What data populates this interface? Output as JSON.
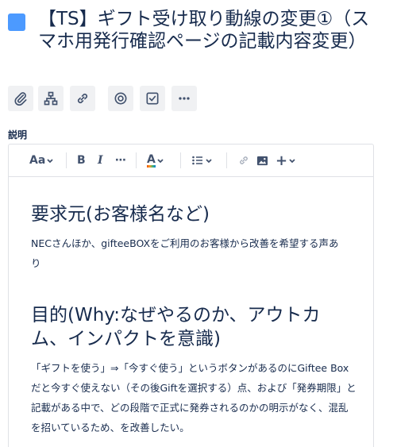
{
  "issue": {
    "title": "【TS】ギフト受け取り動線の変更①（スマホ用発行確認ページの記載内容変更）",
    "type_color": "#4c9aff"
  },
  "actions": [
    {
      "name": "attach-button",
      "icon": "paperclip-icon"
    },
    {
      "name": "child-issue-button",
      "icon": "hierarchy-icon"
    },
    {
      "name": "link-issue-button",
      "icon": "link-icon"
    },
    {
      "name": "watch-button",
      "icon": "target-icon"
    },
    {
      "name": "checklist-button",
      "icon": "checkbox-icon"
    },
    {
      "name": "more-button",
      "icon": "more-icon"
    }
  ],
  "description": {
    "label": "説明",
    "toolbar": {
      "text_style": "Aa",
      "bold": "B",
      "italic": "I",
      "more": "⋯",
      "color": "A",
      "plus": "+"
    },
    "heading1": "要求元(お客様名など)",
    "para1": "NECさんほか、gifteeBOXをご利用のお客様から改善を希望する声あり",
    "heading2": "目的(Why:なぜやるのか、アウトカム、インパクトを意識)",
    "para2": "「ギフトを使う」⇒「今すぐ使う」というボタンがあるのにGiftee Boxだと今すぐ使えない（その後Giftを選択する）点、および「発券期限」と記載がある中で、どの段階で正式に発券されるのかの明示がなく、混乱を招いているため、を改善したい。"
  }
}
